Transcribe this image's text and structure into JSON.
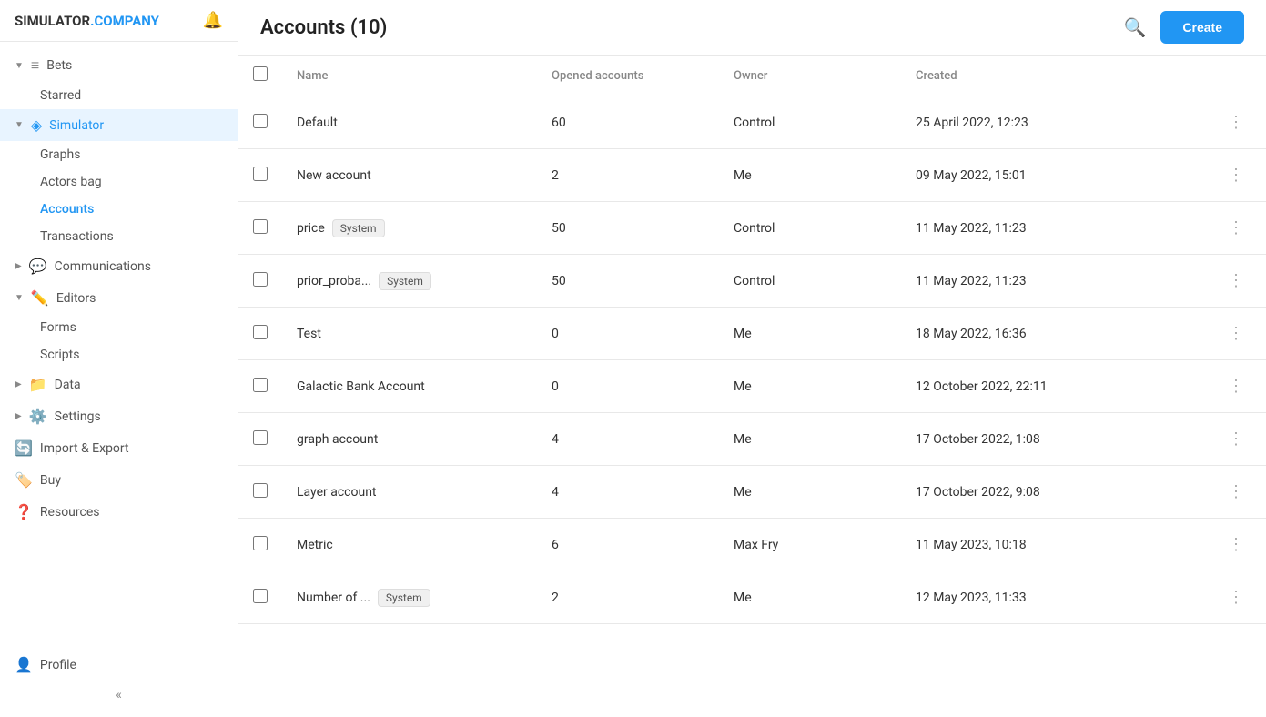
{
  "app": {
    "logo_main": "SIMULATOR",
    "logo_blue": ".COMPANY",
    "bell_icon": "🔔"
  },
  "sidebar": {
    "sections": [
      {
        "label": "Bets",
        "icon": "≡",
        "expanded": true,
        "children": [
          {
            "label": "Starred",
            "active": false
          }
        ]
      },
      {
        "label": "Simulator",
        "icon": "◈",
        "expanded": true,
        "active": true,
        "children": [
          {
            "label": "Graphs",
            "active": false
          },
          {
            "label": "Actors bag",
            "active": false
          },
          {
            "label": "Accounts",
            "active": true
          },
          {
            "label": "Transactions",
            "active": false
          }
        ]
      },
      {
        "label": "Communications",
        "icon": "💬",
        "expanded": false,
        "children": []
      },
      {
        "label": "Editors",
        "icon": "✏️",
        "expanded": true,
        "children": [
          {
            "label": "Forms",
            "active": false
          },
          {
            "label": "Scripts",
            "active": false
          }
        ]
      },
      {
        "label": "Data",
        "icon": "📁",
        "expanded": false,
        "children": []
      },
      {
        "label": "Settings",
        "icon": "⚙️",
        "expanded": false,
        "children": []
      },
      {
        "label": "Import & Export",
        "icon": "🔄",
        "expanded": false,
        "children": []
      },
      {
        "label": "Buy",
        "icon": "🏷️",
        "expanded": false,
        "children": []
      },
      {
        "label": "Resources",
        "icon": "❓",
        "expanded": false,
        "children": []
      }
    ],
    "profile": "Profile",
    "collapse_icon": "«"
  },
  "header": {
    "title": "Accounts (10)",
    "create_label": "Create"
  },
  "table": {
    "columns": [
      "Name",
      "Opened accounts",
      "Owner",
      "Created"
    ],
    "rows": [
      {
        "name": "Default",
        "tag": null,
        "opened": "60",
        "owner": "Control",
        "created": "25 April 2022, 12:23"
      },
      {
        "name": "New account",
        "tag": null,
        "opened": "2",
        "owner": "Me",
        "created": "09 May 2022, 15:01"
      },
      {
        "name": "price",
        "tag": "System",
        "opened": "50",
        "owner": "Control",
        "created": "11 May 2022, 11:23"
      },
      {
        "name": "prior_proba...",
        "tag": "System",
        "opened": "50",
        "owner": "Control",
        "created": "11 May 2022, 11:23"
      },
      {
        "name": "Test",
        "tag": null,
        "opened": "0",
        "owner": "Me",
        "created": "18 May 2022, 16:36"
      },
      {
        "name": "Galactic Bank Account",
        "tag": null,
        "opened": "0",
        "owner": "Me",
        "created": "12 October 2022, 22:11"
      },
      {
        "name": "graph account",
        "tag": null,
        "opened": "4",
        "owner": "Me",
        "created": "17 October 2022, 1:08"
      },
      {
        "name": "Layer account",
        "tag": null,
        "opened": "4",
        "owner": "Me",
        "created": "17 October 2022, 9:08"
      },
      {
        "name": "Metric",
        "tag": null,
        "opened": "6",
        "owner": "Max Fry",
        "created": "11 May 2023, 10:18"
      },
      {
        "name": "Number of ...",
        "tag": "System",
        "opened": "2",
        "owner": "Me",
        "created": "12 May 2023, 11:33"
      }
    ]
  }
}
